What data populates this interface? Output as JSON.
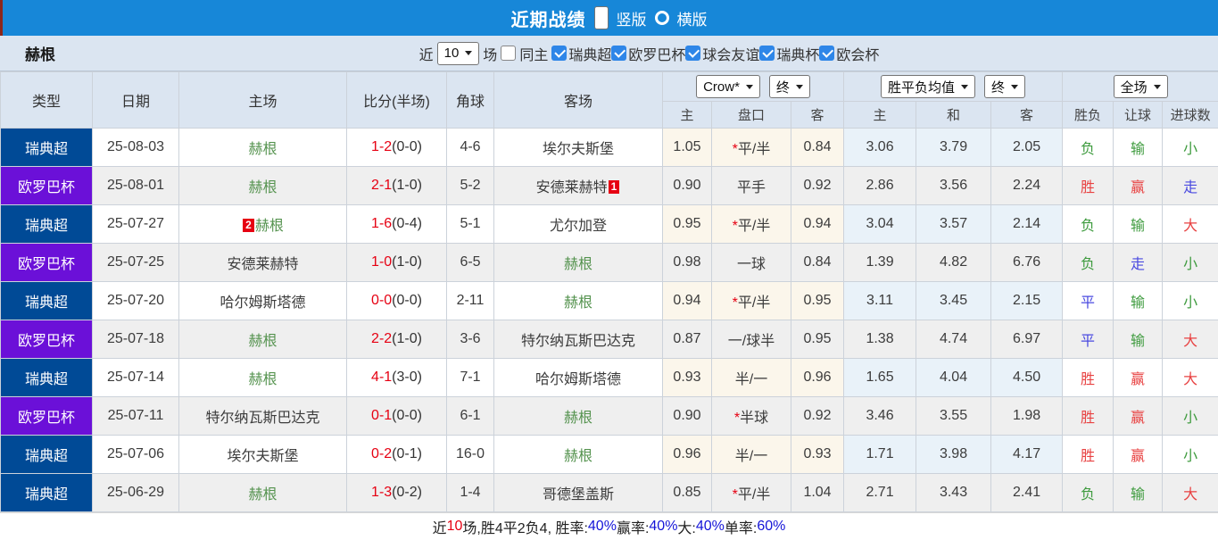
{
  "topbar": {
    "title": "近期战绩",
    "radio_vertical_label": "竖版",
    "radio_horizontal_label": "横版",
    "selected_mode": "竖版"
  },
  "filterbar": {
    "team": "赫根",
    "near_label": "近",
    "near_value": "10",
    "games_label": "场",
    "same_home_label": "同主",
    "same_home_checked": false,
    "leagues": [
      "瑞典超",
      "欧罗巴杯",
      "球会友谊",
      "瑞典杯",
      "欧会杯"
    ]
  },
  "table": {
    "col_headers": [
      "类型",
      "日期",
      "主场",
      "比分(半场)",
      "角球",
      "客场"
    ],
    "sub_headers": [
      "主",
      "盘口",
      "客",
      "主",
      "和",
      "客",
      "胜负",
      "让球",
      "进球数"
    ],
    "selects": {
      "company": "Crow*",
      "company_time": "终",
      "avg": "胜平负均值",
      "avg_time": "终",
      "scope": "全场"
    },
    "rows": [
      {
        "league": "瑞典超",
        "lg": "navy",
        "date": "25-08-03",
        "hb": "",
        "home": "赫根",
        "home_c": "hl",
        "score": "1-2",
        "half": "(0-0)",
        "corners": "4-6",
        "away": "埃尔夫斯堡",
        "away_c": "",
        "ab": "",
        "oh": "1.05",
        "star": "*",
        "hc": "平/半",
        "oa": "0.84",
        "aw": "3.06",
        "ad": "3.79",
        "al": "2.05",
        "res": "负",
        "res_c": "green",
        "let": "输",
        "let_c": "green",
        "goal": "小",
        "goal_c": "green"
      },
      {
        "league": "欧罗巴杯",
        "lg": "purple",
        "date": "25-08-01",
        "hb": "",
        "home": "赫根",
        "home_c": "hl",
        "score": "2-1",
        "half": "(1-0)",
        "corners": "5-2",
        "away": "安德莱赫特",
        "away_c": "",
        "ab": "1",
        "oh": "0.90",
        "star": "",
        "hc": "平手",
        "oa": "0.92",
        "aw": "2.86",
        "ad": "3.56",
        "al": "2.24",
        "res": "胜",
        "res_c": "red",
        "let": "赢",
        "let_c": "red",
        "goal": "走",
        "goal_c": "blue"
      },
      {
        "league": "瑞典超",
        "lg": "navy",
        "date": "25-07-27",
        "hb": "2",
        "home": "赫根",
        "home_c": "hl",
        "score": "1-6",
        "half": "(0-4)",
        "corners": "5-1",
        "away": "尤尔加登",
        "away_c": "",
        "ab": "",
        "oh": "0.95",
        "star": "*",
        "hc": "平/半",
        "oa": "0.94",
        "aw": "3.04",
        "ad": "3.57",
        "al": "2.14",
        "res": "负",
        "res_c": "green",
        "let": "输",
        "let_c": "green",
        "goal": "大",
        "goal_c": "red"
      },
      {
        "league": "欧罗巴杯",
        "lg": "purple",
        "date": "25-07-25",
        "hb": "",
        "home": "安德莱赫特",
        "home_c": "",
        "score": "1-0",
        "half": "(1-0)",
        "corners": "6-5",
        "away": "赫根",
        "away_c": "hl",
        "ab": "",
        "oh": "0.98",
        "star": "",
        "hc": "一球",
        "oa": "0.84",
        "aw": "1.39",
        "ad": "4.82",
        "al": "6.76",
        "res": "负",
        "res_c": "green",
        "let": "走",
        "let_c": "blue",
        "goal": "小",
        "goal_c": "green"
      },
      {
        "league": "瑞典超",
        "lg": "navy",
        "date": "25-07-20",
        "hb": "",
        "home": "哈尔姆斯塔德",
        "home_c": "",
        "score": "0-0",
        "half": "(0-0)",
        "corners": "2-11",
        "away": "赫根",
        "away_c": "hl",
        "ab": "",
        "oh": "0.94",
        "star": "*",
        "hc": "平/半",
        "oa": "0.95",
        "aw": "3.11",
        "ad": "3.45",
        "al": "2.15",
        "res": "平",
        "res_c": "blue",
        "let": "输",
        "let_c": "green",
        "goal": "小",
        "goal_c": "green"
      },
      {
        "league": "欧罗巴杯",
        "lg": "purple",
        "date": "25-07-18",
        "hb": "",
        "home": "赫根",
        "home_c": "hl",
        "score": "2-2",
        "half": "(1-0)",
        "corners": "3-6",
        "away": "特尔纳瓦斯巴达克",
        "away_c": "",
        "ab": "",
        "oh": "0.87",
        "star": "",
        "hc": "一/球半",
        "oa": "0.95",
        "aw": "1.38",
        "ad": "4.74",
        "al": "6.97",
        "res": "平",
        "res_c": "blue",
        "let": "输",
        "let_c": "green",
        "goal": "大",
        "goal_c": "red"
      },
      {
        "league": "瑞典超",
        "lg": "navy",
        "date": "25-07-14",
        "hb": "",
        "home": "赫根",
        "home_c": "hl",
        "score": "4-1",
        "half": "(3-0)",
        "corners": "7-1",
        "away": "哈尔姆斯塔德",
        "away_c": "",
        "ab": "",
        "oh": "0.93",
        "star": "",
        "hc": "半/一",
        "oa": "0.96",
        "aw": "1.65",
        "ad": "4.04",
        "al": "4.50",
        "res": "胜",
        "res_c": "red",
        "let": "赢",
        "let_c": "red",
        "goal": "大",
        "goal_c": "red"
      },
      {
        "league": "欧罗巴杯",
        "lg": "purple",
        "date": "25-07-11",
        "hb": "",
        "home": "特尔纳瓦斯巴达克",
        "home_c": "",
        "score": "0-1",
        "half": "(0-0)",
        "corners": "6-1",
        "away": "赫根",
        "away_c": "hl",
        "ab": "",
        "oh": "0.90",
        "star": "*",
        "hc": "半球",
        "oa": "0.92",
        "aw": "3.46",
        "ad": "3.55",
        "al": "1.98",
        "res": "胜",
        "res_c": "red",
        "let": "赢",
        "let_c": "red",
        "goal": "小",
        "goal_c": "green"
      },
      {
        "league": "瑞典超",
        "lg": "navy",
        "date": "25-07-06",
        "hb": "",
        "home": "埃尔夫斯堡",
        "home_c": "",
        "score": "0-2",
        "half": "(0-1)",
        "corners": "16-0",
        "away": "赫根",
        "away_c": "hl",
        "ab": "",
        "oh": "0.96",
        "star": "",
        "hc": "半/一",
        "oa": "0.93",
        "aw": "1.71",
        "ad": "3.98",
        "al": "4.17",
        "res": "胜",
        "res_c": "red",
        "let": "赢",
        "let_c": "red",
        "goal": "小",
        "goal_c": "green"
      },
      {
        "league": "瑞典超",
        "lg": "navy",
        "date": "25-06-29",
        "hb": "",
        "home": "赫根",
        "home_c": "hl",
        "score": "1-3",
        "half": "(0-2)",
        "corners": "1-4",
        "away": "哥德堡盖斯",
        "away_c": "",
        "ab": "",
        "oh": "0.85",
        "star": "*",
        "hc": "平/半",
        "oa": "1.04",
        "aw": "2.71",
        "ad": "3.43",
        "al": "2.41",
        "res": "负",
        "res_c": "green",
        "let": "输",
        "let_c": "green",
        "goal": "大",
        "goal_c": "red"
      }
    ]
  },
  "footer": {
    "segments": [
      {
        "t": "近",
        "c": "k"
      },
      {
        "t": "10",
        "c": "r"
      },
      {
        "t": "场,胜4平2负4, 胜率:",
        "c": "k"
      },
      {
        "t": "40%",
        "c": "b"
      },
      {
        "t": " 赢率:",
        "c": "k"
      },
      {
        "t": "40%",
        "c": "b"
      },
      {
        "t": " 大:",
        "c": "k"
      },
      {
        "t": "40%",
        "c": "b"
      },
      {
        "t": " 单率:",
        "c": "k"
      },
      {
        "t": "60%",
        "c": "b"
      }
    ]
  },
  "colors": {
    "topbar_blue": "#1787d8",
    "league_swedish_navy": "#004a96",
    "league_europa_purple": "#6b10d8",
    "win_red": "#e84141",
    "lose_green": "#3e9b3e",
    "draw_blue": "#4a4ae0",
    "score_red": "#e60012",
    "team_highlight_green": "#55934f",
    "percent_blue": "#1414d8",
    "header_bg": "#dbe5f1"
  }
}
